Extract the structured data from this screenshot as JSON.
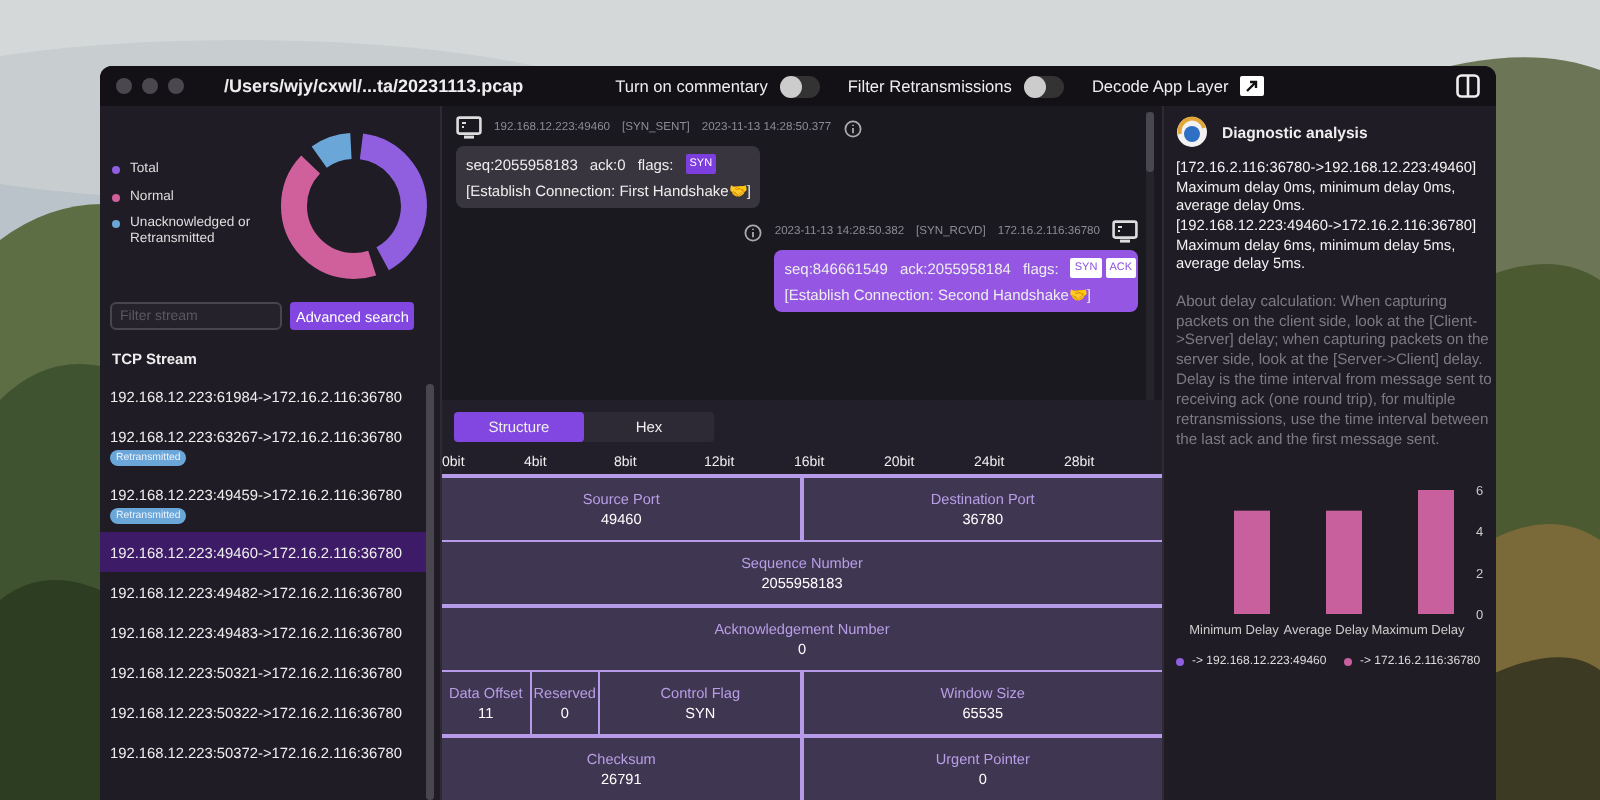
{
  "window": {
    "title": "/Users/wjy/cxwl/...ta/20231113.pcap"
  },
  "toolbar": {
    "toggles": [
      {
        "label": "Turn on commentary",
        "on": false
      },
      {
        "label": "Filter Retransmissions",
        "on": false
      }
    ],
    "decode_label": "Decode App Layer"
  },
  "legend": [
    {
      "label": "Total",
      "color": "#8f5fe0"
    },
    {
      "label": "Normal",
      "color": "#d0609c"
    },
    {
      "label": "Unacknowledged or Retransmitted",
      "color": "#6aa6d8"
    }
  ],
  "filter": {
    "placeholder": "Filter stream",
    "button": "Advanced search"
  },
  "stream_heading": "TCP Stream",
  "streams": [
    {
      "label": "192.168.12.223:61984->172.16.2.116:36780",
      "selected": false
    },
    {
      "label": "192.168.12.223:63267->172.16.2.116:36780",
      "badge": "Retransmitted",
      "selected": false
    },
    {
      "label": "192.168.12.223:49459->172.16.2.116:36780",
      "badge": "Retransmitted",
      "selected": false
    },
    {
      "label": "192.168.12.223:49460->172.16.2.116:36780",
      "selected": true
    },
    {
      "label": "192.168.12.223:49482->172.16.2.116:36780",
      "selected": false
    },
    {
      "label": "192.168.12.223:49483->172.16.2.116:36780",
      "selected": false
    },
    {
      "label": "192.168.12.223:50321->172.16.2.116:36780",
      "selected": false
    },
    {
      "label": "192.168.12.223:50322->172.16.2.116:36780",
      "selected": false
    },
    {
      "label": "192.168.12.223:50372->172.16.2.116:36780",
      "selected": false
    }
  ],
  "messages": [
    {
      "kind": "sent",
      "address": "192.168.12.223:49460",
      "state": "[SYN_SENT]",
      "time": "2023-11-13 14:28:50.377",
      "seq": "seq:2055958183",
      "ack": "ack:0",
      "flags_label": "flags:",
      "flags": [
        "SYN"
      ],
      "note": "[Establish Connection: First Handshake🤝]"
    },
    {
      "kind": "received",
      "address": "172.16.2.116:36780",
      "state": "[SYN_RCVD]",
      "time": "2023-11-13 14:28:50.382",
      "seq": "seq:846661549",
      "ack": "ack:2055958184",
      "flags_label": "flags:",
      "flags": [
        "SYN",
        "ACK"
      ],
      "note": "[Establish Connection: Second Handshake🤝]"
    }
  ],
  "structure_tabs": [
    {
      "label": "Structure",
      "selected": true
    },
    {
      "label": "Hex",
      "selected": false
    }
  ],
  "bit_ticks": [
    "0bit",
    "4bit",
    "8bit",
    "12bit",
    "16bit",
    "20bit",
    "24bit",
    "28bit"
  ],
  "header_rows": [
    [
      {
        "kind": "half",
        "name": "Source Port",
        "value": "49460"
      },
      {
        "kind": "half",
        "name": "Destination Port",
        "value": "36780"
      }
    ],
    [
      {
        "kind": "full",
        "name": "Sequence Number",
        "value": "2055958183"
      }
    ],
    [
      {
        "kind": "full",
        "name": "Acknowledgement Number",
        "value": "0"
      }
    ],
    [
      {
        "kind": "offset",
        "name": "Data Offset",
        "value": "11"
      },
      {
        "kind": "reserved",
        "name": "Reserved",
        "value": "0"
      },
      {
        "kind": "flags",
        "name": "Control Flag",
        "value": "SYN"
      },
      {
        "kind": "half",
        "name": "Window Size",
        "value": "65535"
      }
    ],
    [
      {
        "kind": "half",
        "name": "Checksum",
        "value": "26791"
      },
      {
        "kind": "half",
        "name": "Urgent Pointer",
        "value": "0"
      }
    ]
  ],
  "diagnostic": {
    "title": "Diagnostic analysis",
    "summary": [
      "[172.16.2.116:36780->192.168.12.223:49460] Maximum delay 0ms, minimum delay 0ms, average delay 0ms.",
      "[192.168.12.223:49460->172.16.2.116:36780] Maximum delay 6ms, minimum delay 5ms, average delay 5ms."
    ],
    "note": "About delay calculation: When capturing packets on the client side, look at the [Client->Server] delay; when capturing packets on the server side, look at the [Server->Client] delay. Delay is the time interval from message sent to receiving ack (one round trip), for multiple retransmissions, use the time interval between the last ack and the first message sent.",
    "chart_data": {
      "type": "bar",
      "categories": [
        "Minimum Delay",
        "Average Delay",
        "Maximum Delay"
      ],
      "series": [
        {
          "name": "-> 192.168.12.223:49460",
          "color": "#8f5fe0",
          "values": [
            0,
            0,
            0
          ]
        },
        {
          "name": "-> 172.16.2.116:36780",
          "color": "#c9609e",
          "values": [
            5,
            5,
            6
          ]
        }
      ],
      "ylim": [
        0,
        6
      ],
      "yticks": [
        0,
        2,
        4,
        6
      ]
    }
  }
}
